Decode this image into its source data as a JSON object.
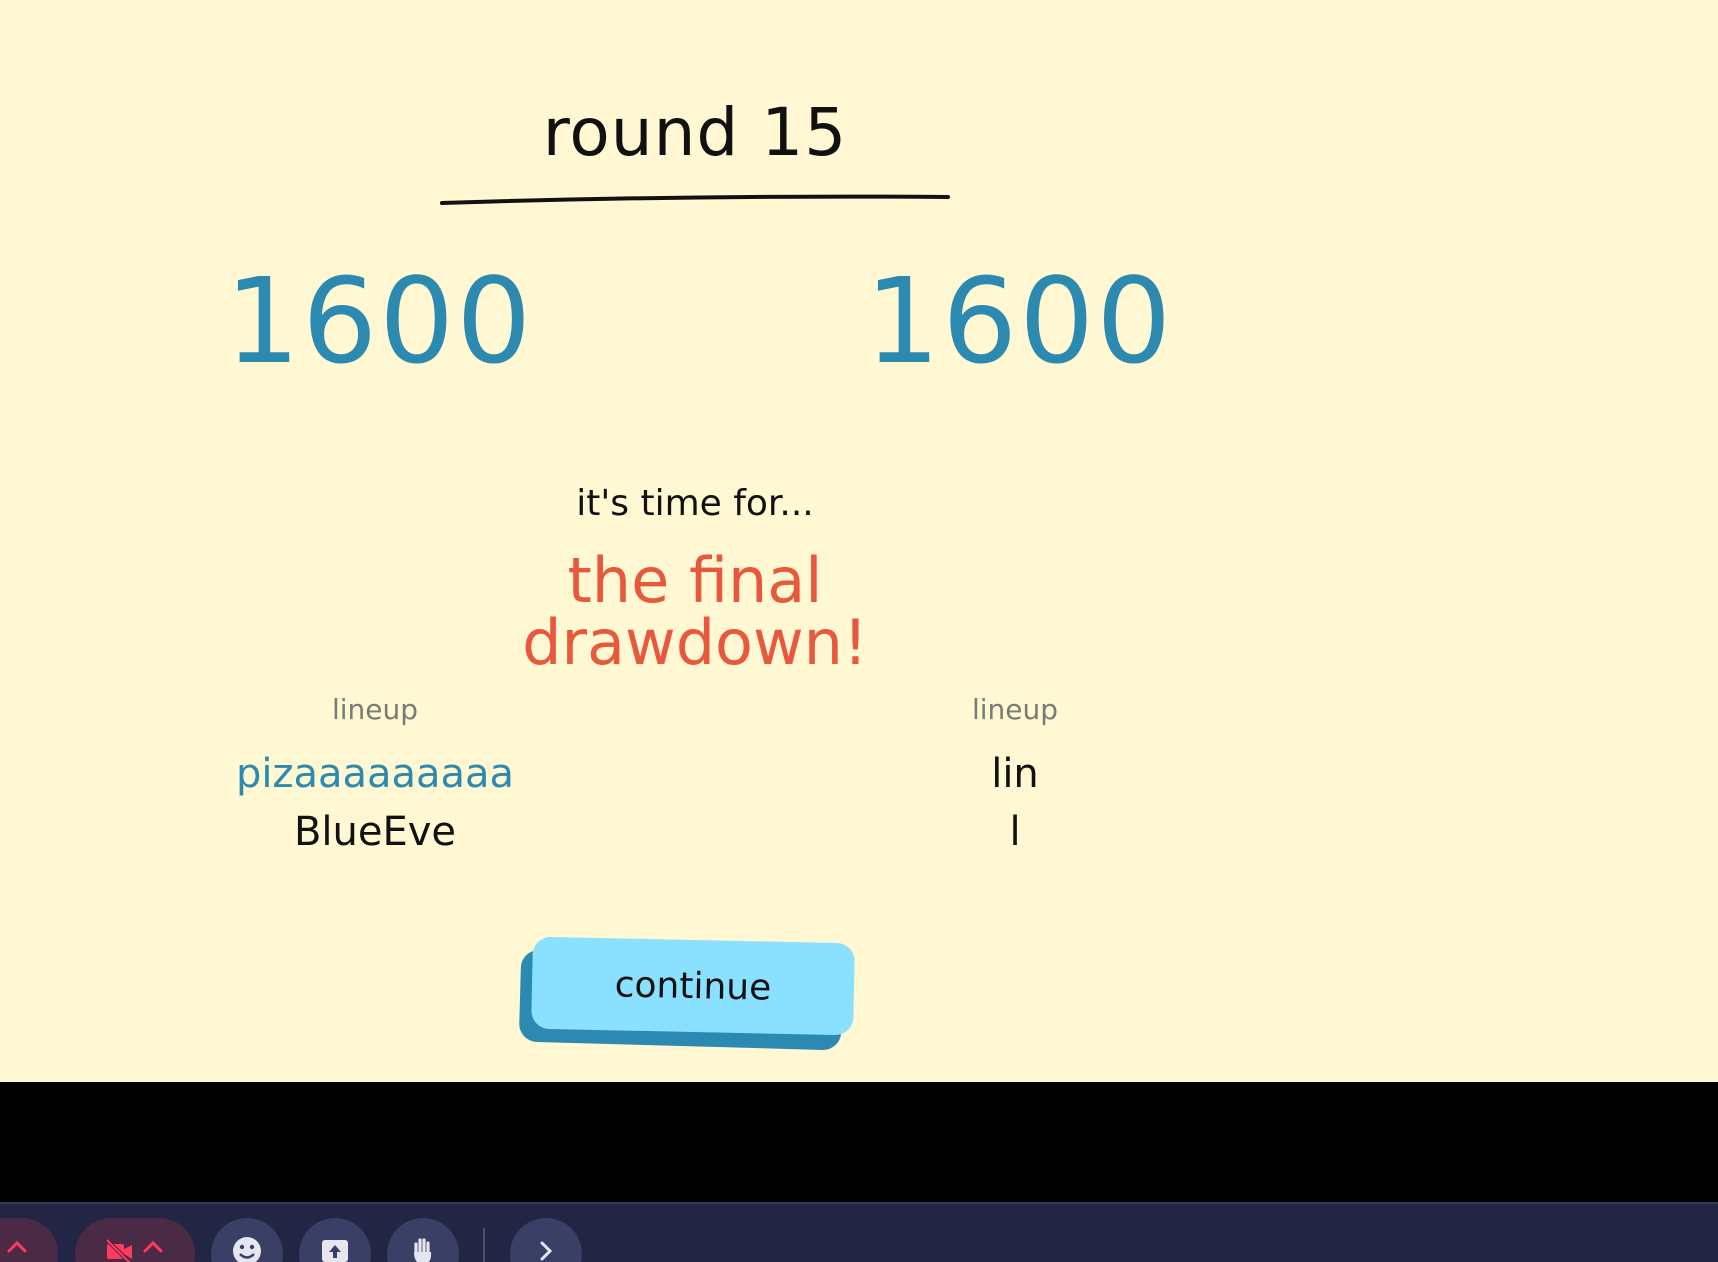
{
  "round": {
    "title": "round 15"
  },
  "scores": {
    "left": "1600",
    "right": "1600"
  },
  "announcement": {
    "intro": "it's time for...",
    "headline": "the final drawdown!"
  },
  "teams": {
    "left": {
      "label": "lineup",
      "players": [
        "pizaaaaaaaaa",
        "BlueEve"
      ]
    },
    "right": {
      "label": "lineup",
      "players": [
        "lin",
        "l"
      ]
    }
  },
  "actions": {
    "continue_label": "continue"
  },
  "toolbar": {
    "icons": [
      "mic-chevron-icon",
      "video-off-icon",
      "chevron-up-icon",
      "emoji-icon",
      "share-screen-icon",
      "raise-hand-icon",
      "chevron-right-icon"
    ]
  },
  "colors": {
    "background": "#fff8d3",
    "score": "#2c8ab0",
    "headline": "#e8583c",
    "button": "#8ae0ff",
    "button_shadow": "#2b89b2",
    "toolbar": "#222543"
  }
}
